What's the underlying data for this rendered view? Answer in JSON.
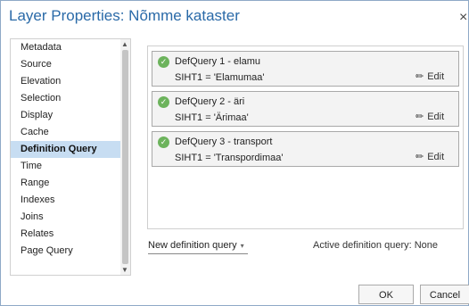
{
  "window": {
    "title": "Layer Properties: Nõmme kataster",
    "close_glyph": "×"
  },
  "sidebar": {
    "items": [
      {
        "label": "Metadata"
      },
      {
        "label": "Source"
      },
      {
        "label": "Elevation"
      },
      {
        "label": "Selection"
      },
      {
        "label": "Display"
      },
      {
        "label": "Cache"
      },
      {
        "label": "Definition Query",
        "selected": true
      },
      {
        "label": "Time"
      },
      {
        "label": "Range"
      },
      {
        "label": "Indexes"
      },
      {
        "label": "Joins"
      },
      {
        "label": "Relates"
      },
      {
        "label": "Page Query"
      }
    ],
    "scroll_up_glyph": "▲",
    "scroll_down_glyph": "▼"
  },
  "queries": [
    {
      "name": "DefQuery 1 - elamu",
      "expression": "SIHT1 = 'Elamumaa'",
      "edit_label": "Edit"
    },
    {
      "name": "DefQuery 2 - äri",
      "expression": "SIHT1 = 'Ärimaa'",
      "edit_label": "Edit"
    },
    {
      "name": "DefQuery 3 - transport",
      "expression": "SIHT1 = 'Transpordimaa'",
      "edit_label": "Edit"
    }
  ],
  "icons": {
    "check": "✓",
    "pencil": "✏"
  },
  "controls": {
    "new_query_label": "New definition query",
    "active_query_label": "Active definition query: None",
    "ok_label": "OK",
    "cancel_label": "Cancel"
  },
  "colors": {
    "accent": "#2a6aa8",
    "selection": "#c7ddf2",
    "check": "#6cb35c",
    "outer_background": "#1f6fb5"
  }
}
